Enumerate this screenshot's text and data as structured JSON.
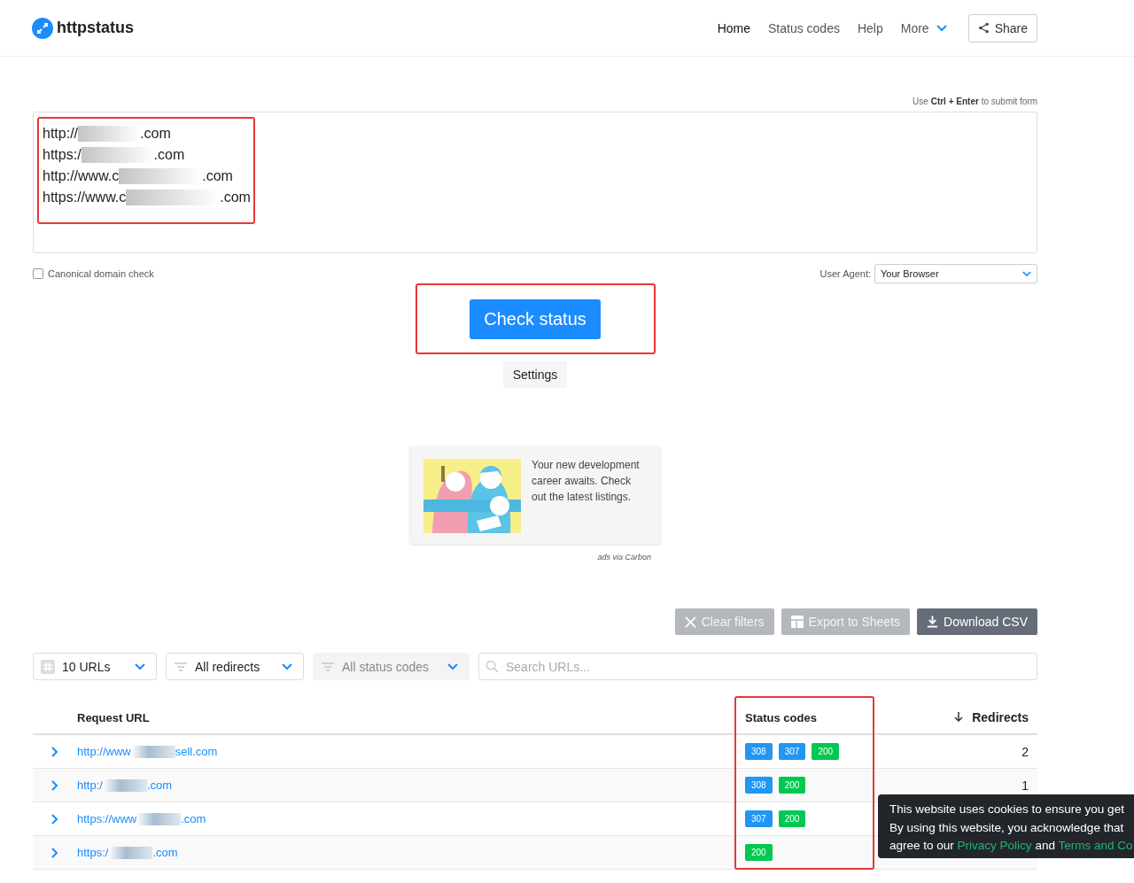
{
  "header": {
    "logo": "httpstatus",
    "nav": [
      {
        "label": "Home",
        "selected": true
      },
      {
        "label": "Status codes",
        "selected": false
      },
      {
        "label": "Help",
        "selected": false
      },
      {
        "label": "More",
        "selected": false,
        "dropdown": true
      }
    ],
    "share": "Share"
  },
  "form": {
    "hint_pre": "Use",
    "hint_keys": "Ctrl + Enter",
    "hint_post": "to submit form",
    "url_lines": [
      {
        "start": "http://",
        "end": ".com"
      },
      {
        "start": "https:/",
        "end": ".com"
      },
      {
        "start": "http://www.c",
        "end": ".com"
      },
      {
        "start": "https://www.c",
        "end": ".com"
      }
    ],
    "canonical": {
      "label": "Canonical domain check",
      "checked": false
    },
    "user_agent_label": "User Agent:",
    "user_agent": "Your Browser",
    "submit": "Check status",
    "settings": "Settings"
  },
  "ad": {
    "text": "Your new development career awaits. Check out the latest listings.",
    "via": "ads via Carbon"
  },
  "actions": [
    {
      "label": "Clear filters",
      "kind": "clear",
      "disabled": true
    },
    {
      "label": "Export to Sheets",
      "kind": "sheets",
      "disabled": true
    },
    {
      "label": "Download CSV",
      "kind": "download",
      "disabled": false
    }
  ],
  "filters": [
    {
      "label": "10 URLs",
      "kind": "count",
      "disabled": false
    },
    {
      "label": "All redirects",
      "kind": "filter",
      "disabled": false
    },
    {
      "label": "All status codes",
      "kind": "filter",
      "disabled": true
    }
  ],
  "search": {
    "placeholder": "Search URLs..."
  },
  "table": {
    "columns": [
      "Request URL",
      "Status codes",
      "Redirects"
    ],
    "rows": [
      {
        "url_start": "http://www",
        "url_end": "sell.com",
        "codes": [
          {
            "code": "308",
            "color": "#2196f3"
          },
          {
            "code": "307",
            "color": "#2196f3"
          },
          {
            "code": "200",
            "color": "#00c853"
          }
        ],
        "redirects": "2"
      },
      {
        "url_start": "http:/",
        "url_end": ".com",
        "codes": [
          {
            "code": "308",
            "color": "#2196f3"
          },
          {
            "code": "200",
            "color": "#00c853"
          }
        ],
        "redirects": "1"
      },
      {
        "url_start": "https://www",
        "url_end": ".com",
        "codes": [
          {
            "code": "307",
            "color": "#2196f3"
          },
          {
            "code": "200",
            "color": "#00c853"
          }
        ],
        "redirects": ""
      },
      {
        "url_start": "https:/",
        "url_end": ".com",
        "codes": [
          {
            "code": "200",
            "color": "#00c853"
          }
        ],
        "redirects": ""
      }
    ]
  },
  "cookie": {
    "line1": "This website uses cookies to ensure you get",
    "line2": "By using this website, you acknowledge that",
    "line3": "agree to our",
    "privacy": "Privacy Policy",
    "and": "and",
    "terms": "Terms and Co"
  }
}
